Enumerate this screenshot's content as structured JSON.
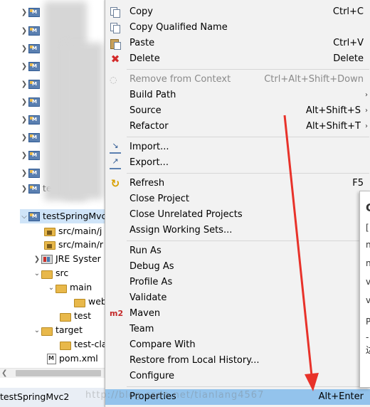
{
  "explorer": {
    "project_label": "testSpringMvc",
    "partial_label_test": "test",
    "rows": [
      {
        "label": "src/main/j"
      },
      {
        "label": "src/main/r"
      },
      {
        "label": "JRE Syster"
      },
      {
        "label": "src"
      },
      {
        "label": "main"
      },
      {
        "label": "web"
      },
      {
        "label": "test"
      },
      {
        "label": "target"
      },
      {
        "label": "test-cla"
      },
      {
        "label": "pom.xml"
      }
    ],
    "status_text": "testSpringMvc2"
  },
  "menu": {
    "items": [
      {
        "label": "Copy",
        "accel": "Ctrl+C",
        "icon": "copy-icon"
      },
      {
        "label": "Copy Qualified Name",
        "accel": "",
        "icon": "copy-qualified-icon"
      },
      {
        "label": "Paste",
        "accel": "Ctrl+V",
        "icon": "paste-icon"
      },
      {
        "label": "Delete",
        "accel": "Delete",
        "icon": "delete-icon"
      },
      {
        "label": "Remove from Context",
        "accel": "Ctrl+Alt+Shift+Down",
        "icon": "remove-context-icon",
        "disabled": true
      },
      {
        "label": "Build Path",
        "accel": "",
        "submenu": true
      },
      {
        "label": "Source",
        "accel": "Alt+Shift+S",
        "submenu": true
      },
      {
        "label": "Refactor",
        "accel": "Alt+Shift+T",
        "submenu": true
      },
      {
        "label": "Import...",
        "accel": "",
        "icon": "import-icon"
      },
      {
        "label": "Export...",
        "accel": "",
        "icon": "export-icon"
      },
      {
        "label": "Refresh",
        "accel": "F5",
        "icon": "refresh-icon"
      },
      {
        "label": "Close Project",
        "accel": ""
      },
      {
        "label": "Close Unrelated Projects",
        "accel": ""
      },
      {
        "label": "Assign Working Sets...",
        "accel": ""
      },
      {
        "label": "Run As",
        "accel": ""
      },
      {
        "label": "Debug As",
        "accel": ""
      },
      {
        "label": "Profile As",
        "accel": ""
      },
      {
        "label": "Validate",
        "accel": ""
      },
      {
        "label": "Maven",
        "accel": "",
        "icon": "maven-icon",
        "icon_text": "m2"
      },
      {
        "label": "Team",
        "accel": ""
      },
      {
        "label": "Compare With",
        "accel": ""
      },
      {
        "label": "Restore from Local History...",
        "accel": ""
      },
      {
        "label": "Configure",
        "accel": ""
      },
      {
        "label": "Properties",
        "accel": "Alt+Enter",
        "highlighted": true
      }
    ],
    "submenu_glyph": "›"
  },
  "popup": {
    "chars": [
      "C",
      "[",
      "n",
      "n",
      "v",
      "v",
      "P",
      "-",
      "边"
    ]
  },
  "watermark": "http://blog.csdn.net/tianlang4567",
  "colors": {
    "menu_bg": "#f2f2f2",
    "highlight": "#93c3ec",
    "arrow": "#e8322a"
  }
}
